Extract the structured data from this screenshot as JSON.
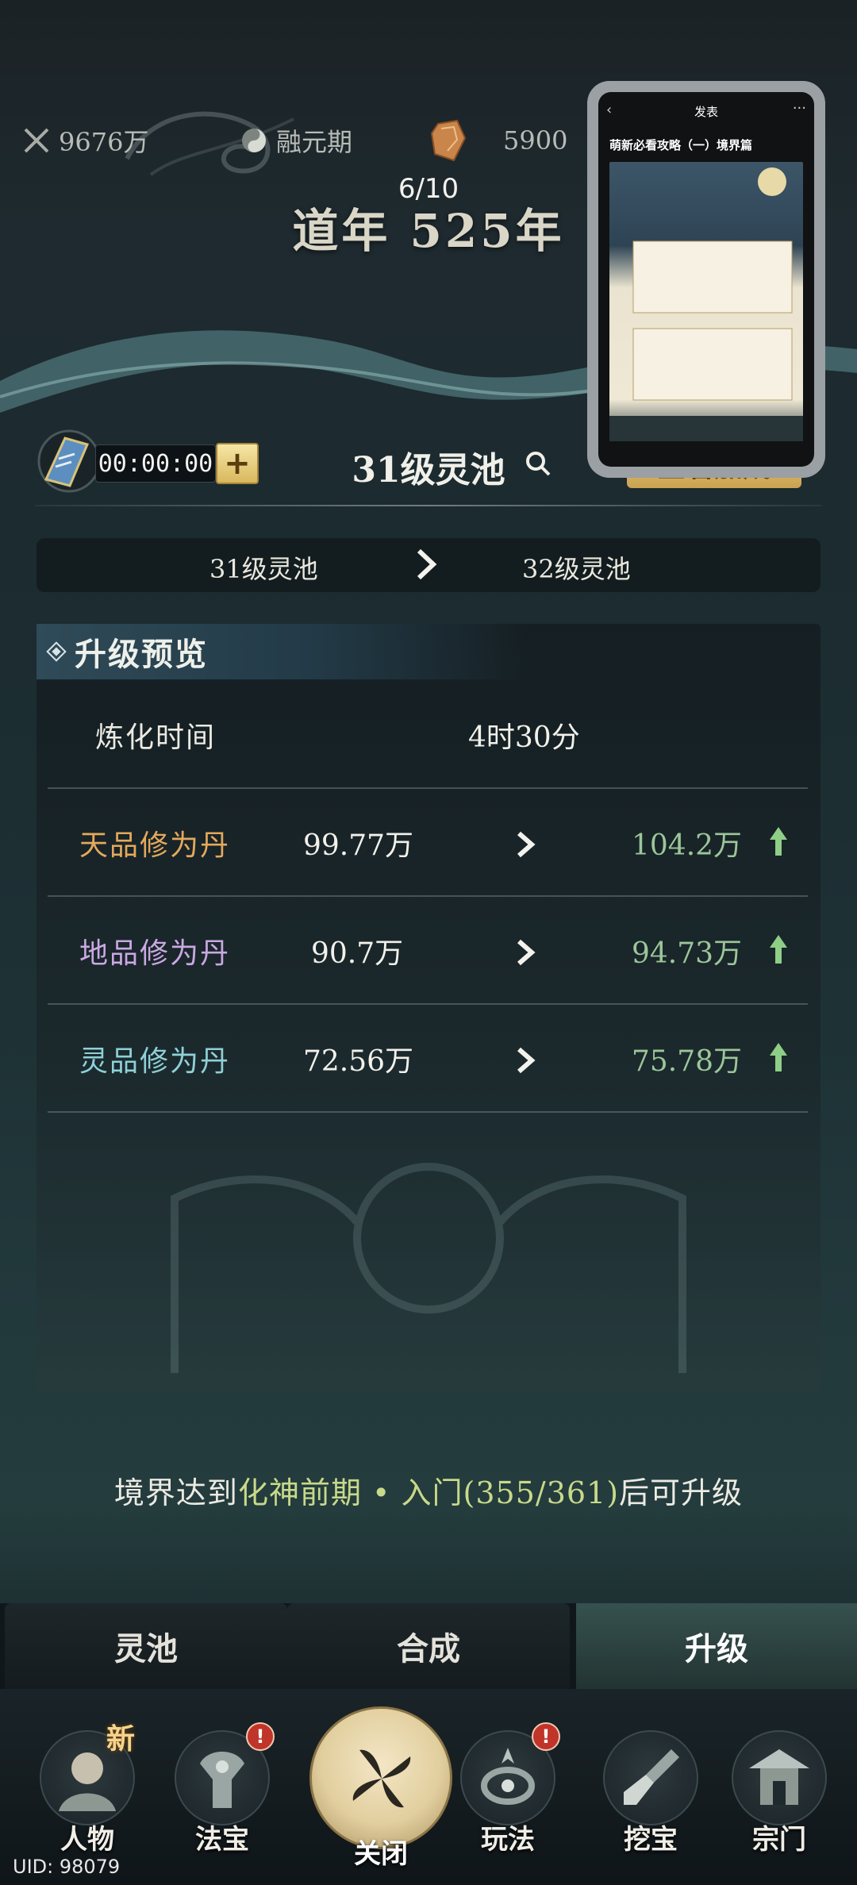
{
  "topbar": {
    "power": "9676万",
    "realm": "融元期",
    "currency": "5900"
  },
  "banner": {
    "counter": "6/10",
    "year": "道年 525年"
  },
  "pool": {
    "timer": "00:00:00",
    "plus_label": "+",
    "title": "31级灵池",
    "view_button": "查看加成"
  },
  "pip": {
    "back": "‹",
    "header": "发表",
    "more": "···",
    "title": "萌新必看攻略（一）境界篇"
  },
  "compare": {
    "from": "31级灵池",
    "to": "32级灵池"
  },
  "preview": {
    "title": "升级预览",
    "time_label": "炼化时间",
    "time_value": "4时30分",
    "rows": [
      {
        "name": "天品修为丹",
        "current": "99.77万",
        "next": "104.2万",
        "color": "#e4a95c"
      },
      {
        "name": "地品修为丹",
        "current": "90.7万",
        "next": "94.73万",
        "color": "#c9a8e2"
      },
      {
        "name": "灵品修为丹",
        "current": "72.56万",
        "next": "75.78万",
        "color": "#8fd0d8"
      }
    ]
  },
  "requirement": {
    "prefix": "境界达到",
    "realm": "化神前期",
    "dot": " • ",
    "stage": "入门(355/361)",
    "suffix": "后可升级"
  },
  "tabs": [
    "灵池",
    "合成",
    "升级"
  ],
  "nav": {
    "items": [
      {
        "label": "人物",
        "tag": "新",
        "icon": "character-icon"
      },
      {
        "label": "法宝",
        "badge": "!",
        "icon": "treasure-icon"
      },
      {
        "label": "关闭",
        "icon": "close-icon"
      },
      {
        "label": "玩法",
        "badge": "!",
        "icon": "gameplay-icon"
      },
      {
        "label": "挖宝",
        "icon": "shovel-icon"
      },
      {
        "label": "宗门",
        "icon": "sect-icon"
      }
    ]
  },
  "uid": "UID: 98079",
  "colors": {
    "accent_gold": "#d9b85e",
    "increase_green": "#9cc69a",
    "highlight_green": "#c8d98a"
  }
}
